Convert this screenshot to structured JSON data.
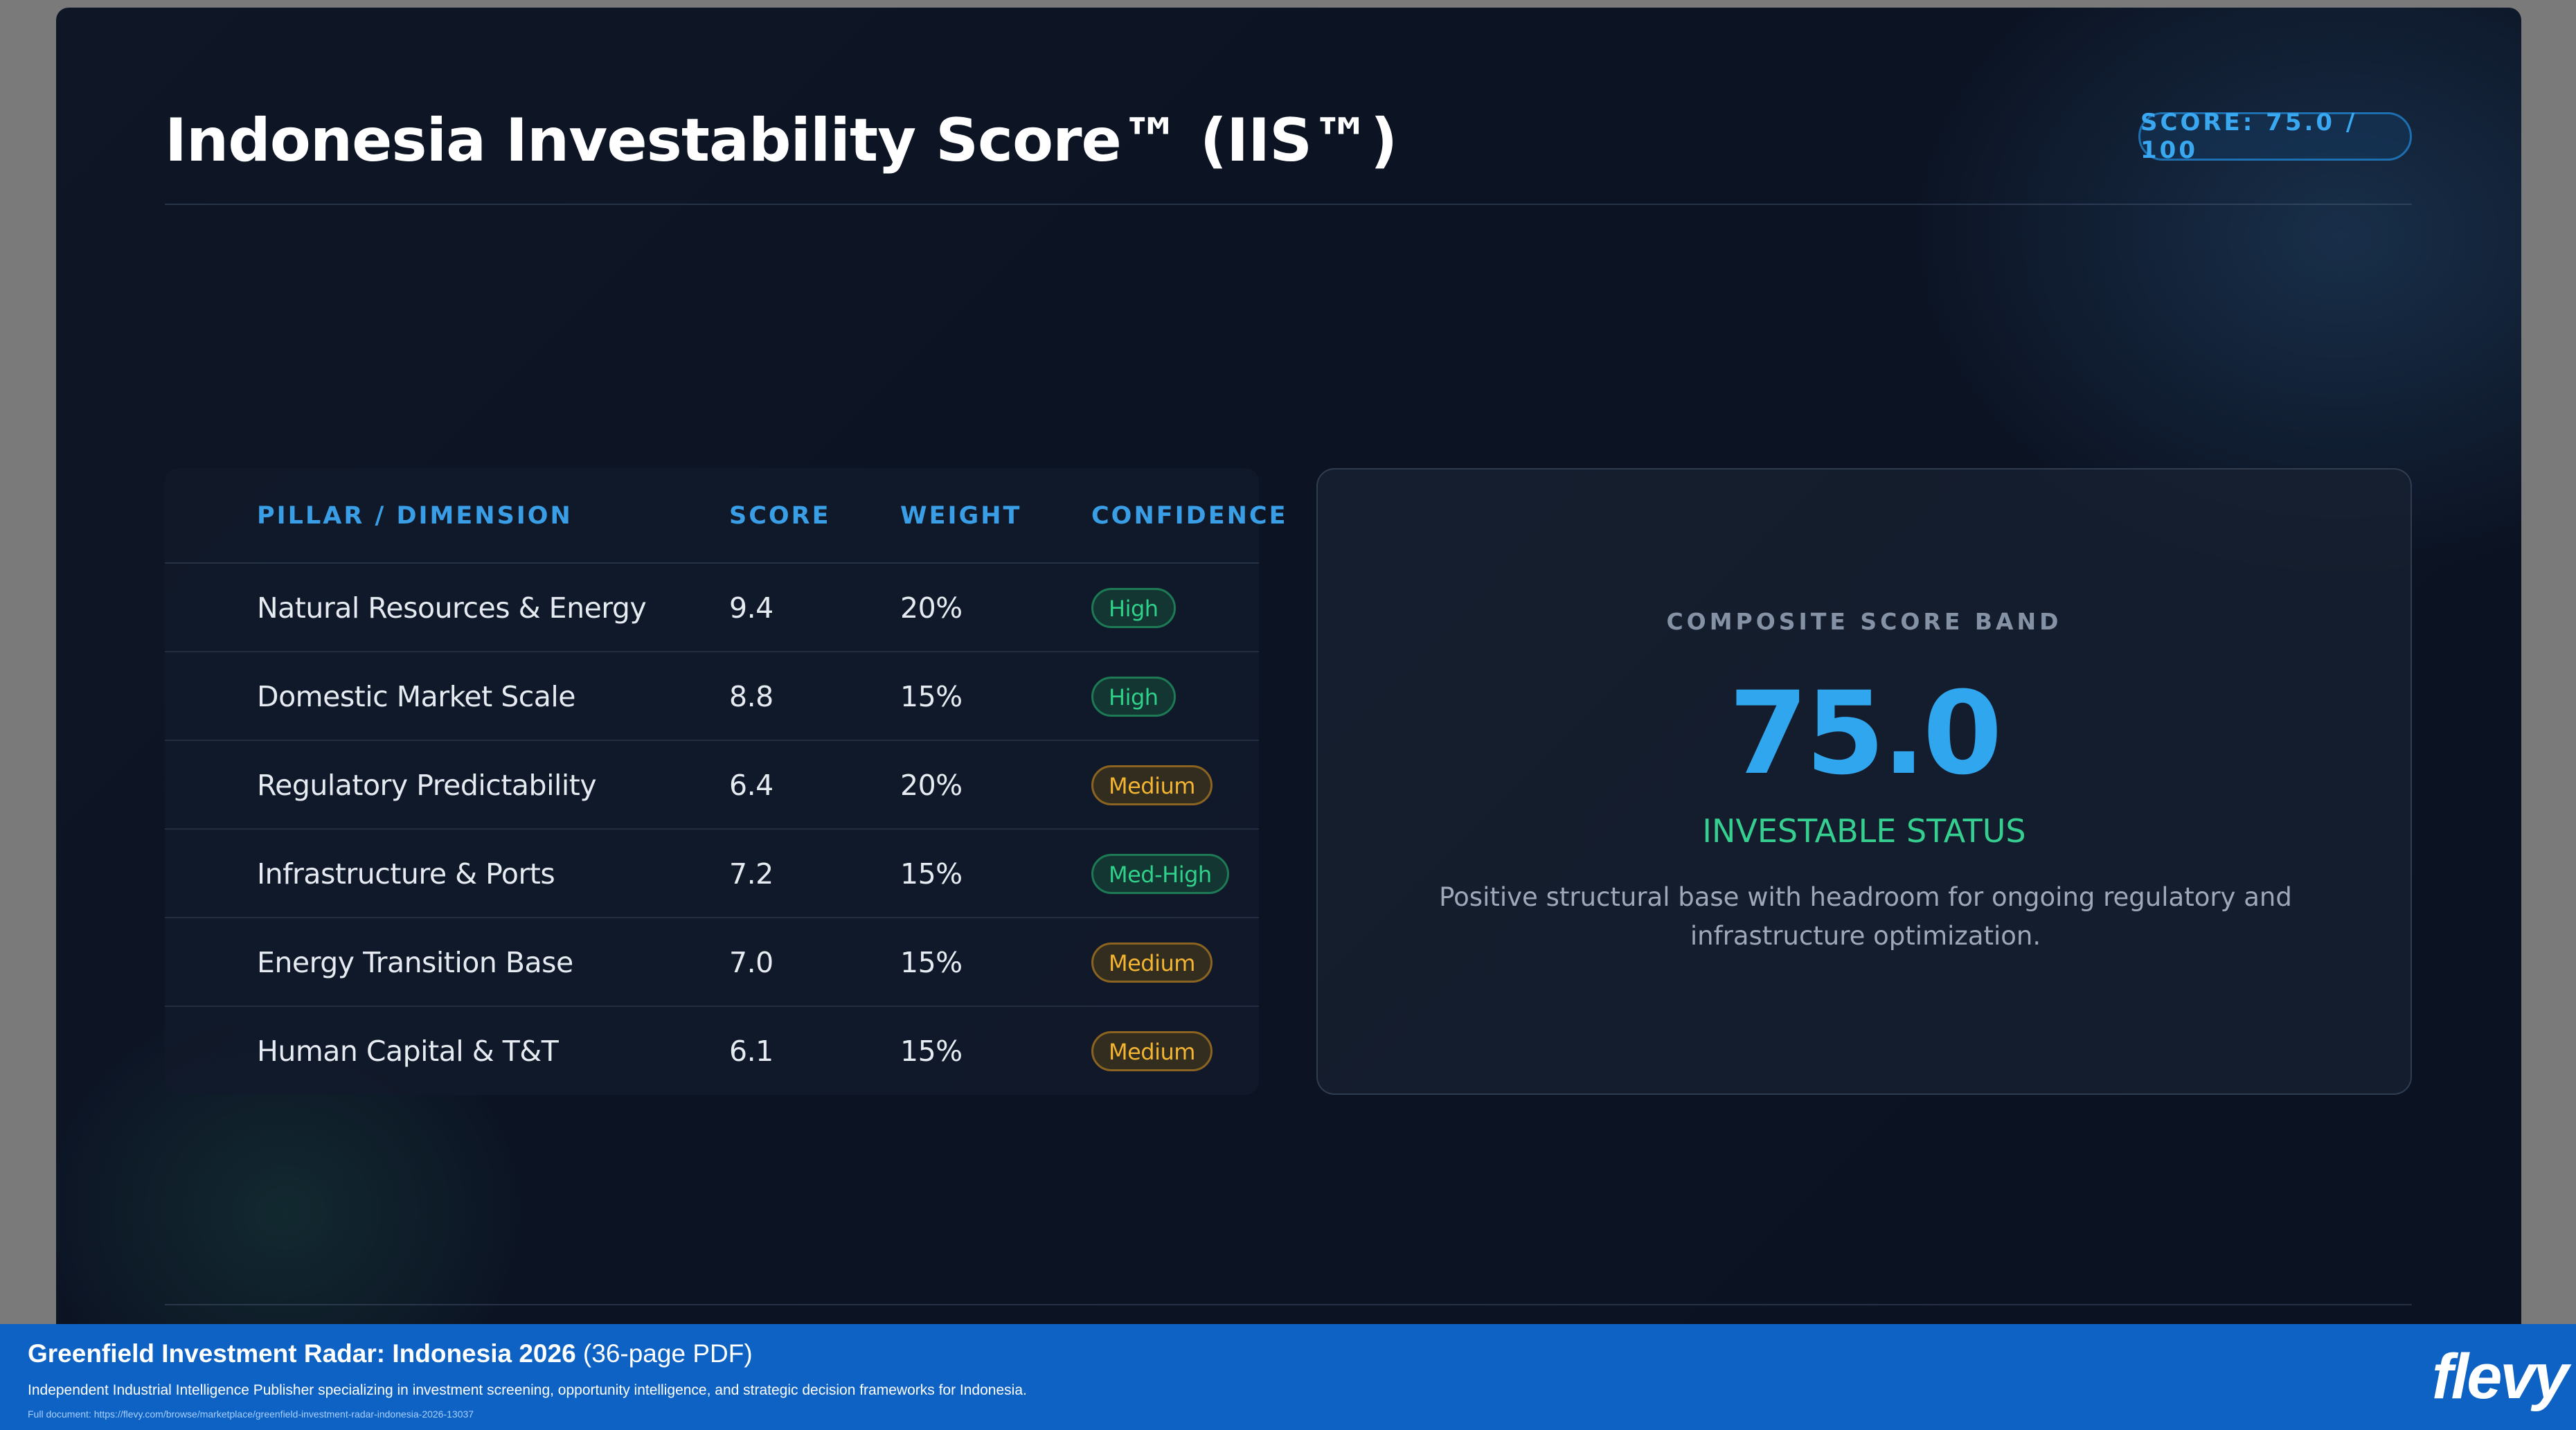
{
  "slide": {
    "title": "Indonesia Investability Score™ (IIS™)",
    "score_pill": "SCORE: 75.0 / 100"
  },
  "table": {
    "headers": [
      "PILLAR / DIMENSION",
      "SCORE",
      "WEIGHT",
      "CONFIDENCE"
    ],
    "rows": [
      {
        "pillar": "Natural Resources & Energy",
        "score": "9.4",
        "weight": "20%",
        "confidence": "High"
      },
      {
        "pillar": "Domestic Market Scale",
        "score": "8.8",
        "weight": "15%",
        "confidence": "High"
      },
      {
        "pillar": "Regulatory Predictability",
        "score": "6.4",
        "weight": "20%",
        "confidence": "Medium"
      },
      {
        "pillar": "Infrastructure & Ports",
        "score": "7.2",
        "weight": "15%",
        "confidence": "Med-High"
      },
      {
        "pillar": "Energy Transition Base",
        "score": "7.0",
        "weight": "15%",
        "confidence": "Medium"
      },
      {
        "pillar": "Human Capital & T&T",
        "score": "6.1",
        "weight": "15%",
        "confidence": "Medium"
      }
    ]
  },
  "band": {
    "label": "COMPOSITE SCORE BAND",
    "score": "75.0",
    "status": "INVESTABLE STATUS",
    "description": "Positive structural base with headroom for ongoing regulatory and infrastructure optimization."
  },
  "footer": {
    "title_bold": "Greenfield Investment Radar: Indonesia 2026",
    "title_suffix": " (36-page PDF)",
    "subtitle": "Independent Industrial Intelligence Publisher specializing in investment screening, opportunity intelligence, and strategic decision frameworks for Indonesia.",
    "url": "Full document: https://flevy.com/browse/marketplace/greenfield-investment-radar-indonesia-2026-13037",
    "brand": "flevy"
  },
  "colors": {
    "accent_blue": "#2fa6ee",
    "status_green": "#35cf90",
    "badge_green": "#2fd08a",
    "badge_amber": "#f2b431",
    "footer_blue": "#0d62c4"
  }
}
